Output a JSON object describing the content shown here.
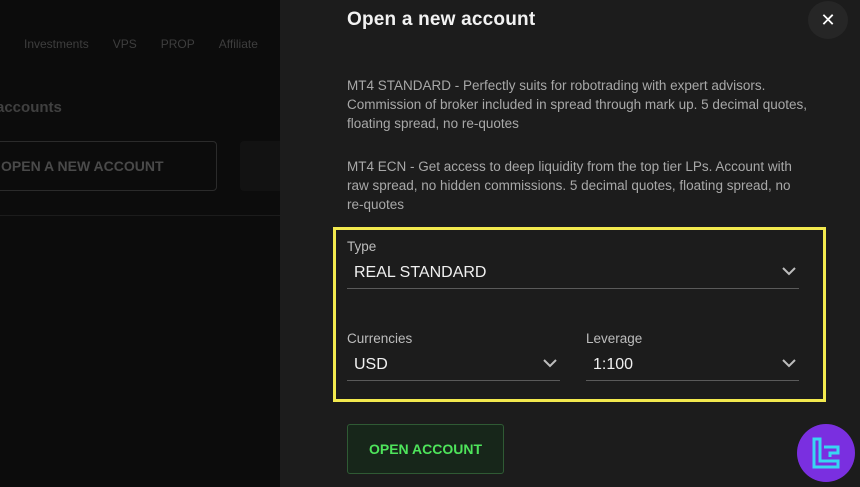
{
  "background": {
    "nav": [
      "Investments",
      "VPS",
      "PROP",
      "Affiliate"
    ],
    "heading": "accounts",
    "open_button": "OPEN A NEW ACCOUNT"
  },
  "modal": {
    "title": "Open a new account",
    "close_label": "✕",
    "descriptions": [
      "MT4 STANDARD - Perfectly suits for robotrading with expert advisors. Commission of broker included in spread through mark up. 5 decimal quotes, floating spread, no re-quotes",
      "MT4 ECN - Get access to deep liquidity from the top tier LPs. Account with raw spread, no hidden commissions. 5 decimal quotes, floating spread, no re-quotes"
    ],
    "type": {
      "label": "Type",
      "value": "REAL STANDARD"
    },
    "currencies": {
      "label": "Currencies",
      "value": "USD"
    },
    "leverage": {
      "label": "Leverage",
      "value": "1:100"
    },
    "submit_label": "OPEN ACCOUNT"
  },
  "colors": {
    "modal_bg": "#1c1c1c",
    "accent_green": "#4ee45b",
    "highlight_yellow": "#f2e94e",
    "logo_purple": "#7a2fe0"
  },
  "icons": [
    "close-icon",
    "chevron-down-icon",
    "brand-logo-icon"
  ]
}
